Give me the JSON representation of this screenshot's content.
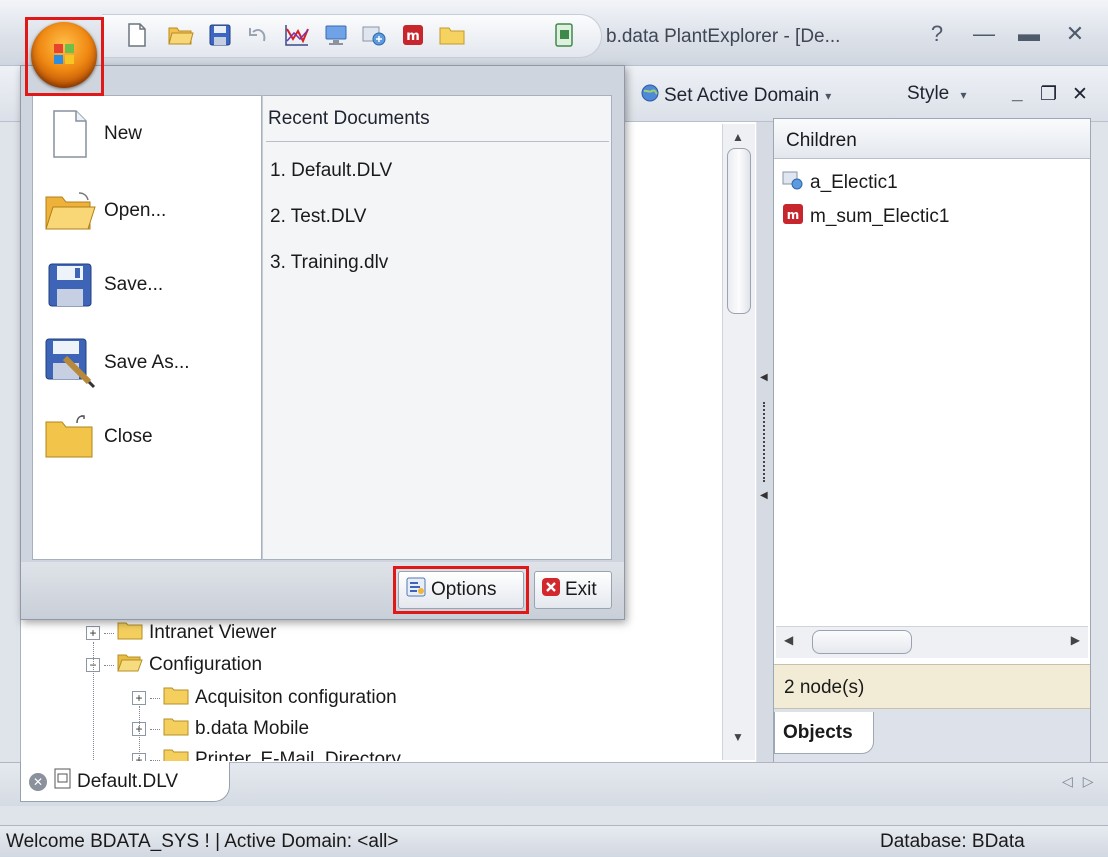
{
  "window": {
    "title": "b.data PlantExplorer - [De...",
    "help_glyph": "?",
    "minimize_glyph": "—",
    "maximize_glyph": "▬",
    "close_glyph": "✕"
  },
  "toolbar": {
    "set_active_domain": "Set Active Domain",
    "style": "Style",
    "caret": "▾",
    "doc_minimize": "_",
    "doc_restore": "❐",
    "doc_close": "✕"
  },
  "app_menu": {
    "items": [
      {
        "label": "New",
        "icon": "new-document-icon"
      },
      {
        "label": "Open...",
        "icon": "open-folder-icon"
      },
      {
        "label": "Save...",
        "icon": "save-disk-icon"
      },
      {
        "label": "Save As...",
        "icon": "save-as-icon"
      },
      {
        "label": "Close",
        "icon": "close-folder-icon"
      }
    ],
    "recent_header": "Recent Documents",
    "recent": [
      "1. Default.DLV",
      "2. Test.DLV",
      "3. Training.dlv"
    ],
    "options_label": "Options",
    "exit_label": "Exit"
  },
  "tree": {
    "items": [
      {
        "label": "Intranet Viewer",
        "expander": "+"
      },
      {
        "label": "Configuration",
        "expander": "−"
      },
      {
        "label": "Acquisiton configuration",
        "expander": "+"
      },
      {
        "label": "b.data Mobile",
        "expander": "+"
      },
      {
        "label": "Printer, E-Mail, Directory",
        "expander": "+"
      }
    ]
  },
  "right_panel": {
    "header": "Children",
    "items": [
      {
        "label": "a_Electic1",
        "icon": "analog-signal-icon"
      },
      {
        "label": "m_sum_Electic1",
        "icon": "m-object-icon"
      }
    ],
    "node_count": "2 node(s)",
    "tab": "Objects"
  },
  "doc_tabs": {
    "active": "Default.DLV",
    "nav": "◁▷"
  },
  "status": {
    "left": "Welcome BDATA_SYS ! | Active Domain: <all>",
    "right": "Database: BData"
  },
  "colors": {
    "highlight_frame": "#e01818",
    "orb": "#f08a13",
    "node_count_bg": "#f2ecd7"
  }
}
